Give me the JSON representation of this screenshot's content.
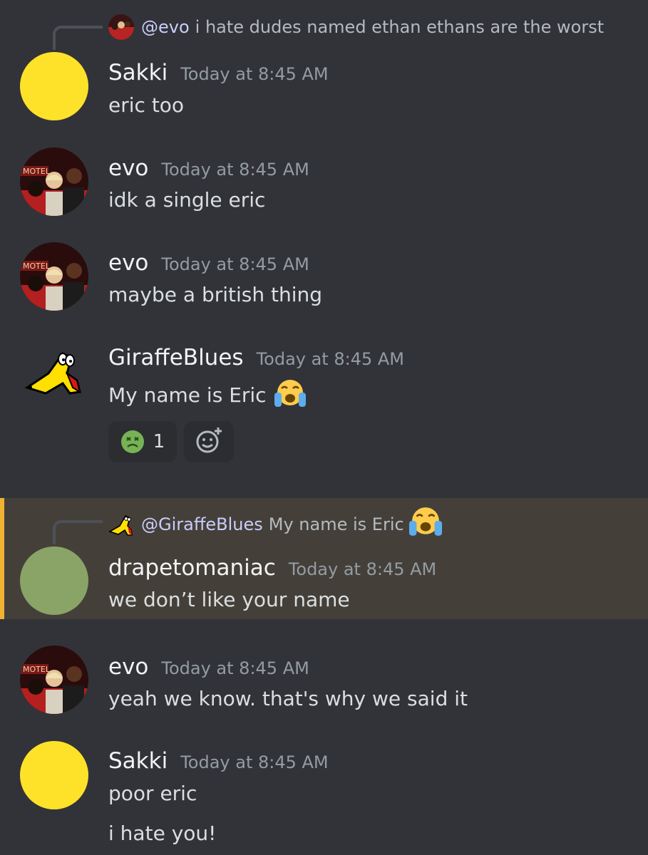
{
  "messages": [
    {
      "reply": {
        "mention": "@evo",
        "text": "i hate dudes named ethan ethans are the worst"
      },
      "author": "Sakki",
      "author_color": "#f2f3f5",
      "timestamp": "Today at 8:45 AM",
      "lines": [
        "eric too"
      ]
    },
    {
      "author": "evo",
      "author_color": "#f2f3f5",
      "timestamp": "Today at 8:45 AM",
      "lines": [
        "idk a single eric"
      ]
    },
    {
      "author": "evo",
      "author_color": "#f2f3f5",
      "timestamp": "Today at 8:45 AM",
      "lines": [
        "maybe a british thing"
      ]
    },
    {
      "author": "GiraffeBlues",
      "author_color": "#f2f3f5",
      "timestamp": "Today at 8:45 AM",
      "lines": [
        "My name is Eric"
      ],
      "reactions": [
        {
          "emoji": "nauseated-face",
          "count": "1"
        }
      ]
    },
    {
      "reply": {
        "mention": "@GiraffeBlues",
        "text": "My name is Eric"
      },
      "author": "drapetomaniac",
      "author_color": "#f2f3f5",
      "timestamp": "Today at 8:45 AM",
      "lines": [
        "we don’t like your name"
      ],
      "highlighted": true
    },
    {
      "author": "evo",
      "author_color": "#f2f3f5",
      "timestamp": "Today at 8:45 AM",
      "lines": [
        "yeah we know. that's why we said it"
      ]
    },
    {
      "author": "Sakki",
      "author_color": "#f2f3f5",
      "timestamp": "Today at 8:45 AM",
      "lines": [
        "poor eric",
        "i hate you!"
      ]
    }
  ],
  "colors": {
    "background": "#313338",
    "highlight_bg": "#444039",
    "highlight_bar": "#f0b232",
    "sakki_avatar": "#fee229",
    "drapetomaniac_avatar": "#8aa367"
  }
}
